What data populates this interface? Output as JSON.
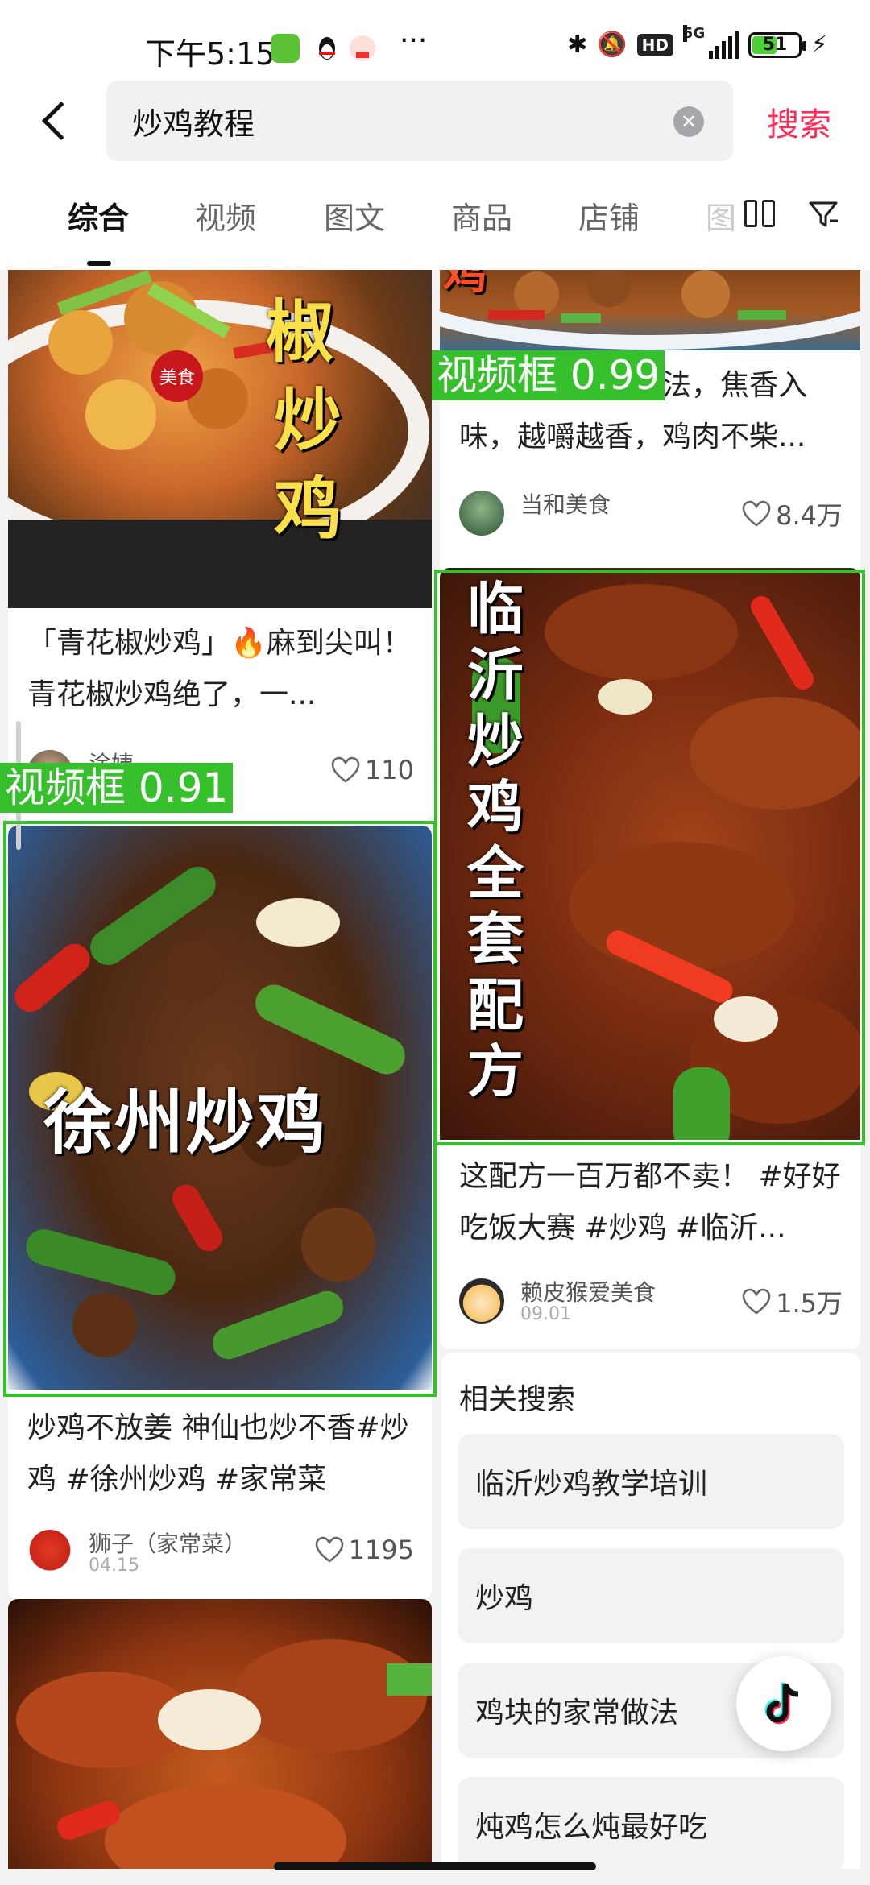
{
  "status_bar": {
    "time": "下午5:15",
    "dots": "···",
    "network": "5G",
    "battery": "51"
  },
  "search": {
    "back_icon": "chevron-left-icon",
    "query": "炒鸡教程",
    "clear_icon": "clear-icon",
    "search_label": "搜索"
  },
  "tabs": {
    "items": [
      "综合",
      "视频",
      "图文",
      "商品",
      "店铺"
    ],
    "faded_label": "图",
    "layout_icon": "grid-layout-icon",
    "filter_icon": "filter-icon"
  },
  "cards": [
    {
      "overlay": [
        "椒",
        "炒",
        "鸡"
      ],
      "badge": "美食",
      "title": "「青花椒炒鸡」🔥麻到尖叫！青花椒炒鸡绝了，一...",
      "author": "涂姨",
      "likes": "110"
    },
    {
      "overlay": "鸡",
      "title": "特色生炒鸡的做法，焦香入味，越嚼越香，鸡肉不柴...",
      "author": "当和美食",
      "likes": "8.4万"
    },
    {
      "overlay": "徐州炒鸡",
      "title": "炒鸡不放姜 神仙也炒不香#炒鸡 #徐州炒鸡 #家常菜",
      "author": "狮子（家常菜）",
      "date": "04.15",
      "likes": "1195"
    },
    {
      "overlay": [
        "临",
        "沂",
        "炒",
        "鸡",
        "全",
        "套",
        "配",
        "方"
      ],
      "title": "这配方一百万都不卖！ #好好吃饭大赛 #炒鸡 #临沂...",
      "author": "赖皮猴爱美食",
      "date": "09.01",
      "likes": "1.5万"
    }
  ],
  "detections": [
    {
      "label": "视频框 0.99"
    },
    {
      "label": "视频框 0.91"
    }
  ],
  "related": {
    "title": "相关搜索",
    "items": [
      "临沂炒鸡教学培训",
      "炒鸡",
      "鸡块的家常做法",
      "炖鸡怎么炖最好吃"
    ]
  },
  "fab_icon": "tiktok-icon",
  "colors": {
    "accent": "#fe2c55",
    "detect": "#36c12c"
  }
}
